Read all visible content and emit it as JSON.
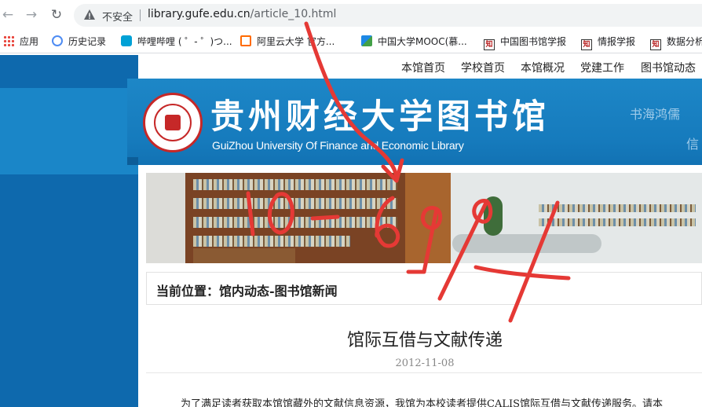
{
  "browser": {
    "not_secure": "不安全",
    "url_host": "library.gufe.edu.cn",
    "url_path": "/article_10.html",
    "bookmarks": [
      {
        "label": "应用",
        "icon": "apps-grid-icon"
      },
      {
        "label": "历史记录",
        "icon": "history-icon"
      },
      {
        "label": "哔哩哔哩 ( ゜- ゜)つ...",
        "icon": "bilibili-icon"
      },
      {
        "label": "阿里云大学 官方...",
        "icon": "aliyun-icon"
      },
      {
        "label": "中国大学MOOC(慕...",
        "icon": "mooc-icon"
      },
      {
        "label": "中国图书馆学报",
        "icon": "zhiwang-icon"
      },
      {
        "label": "情报学报",
        "icon": "zhiwang-icon"
      },
      {
        "label": "数据分析",
        "icon": "zhiwang-icon"
      }
    ]
  },
  "topnav": [
    "本馆首页",
    "学校首页",
    "本馆概况",
    "党建工作",
    "图书馆动态"
  ],
  "banner": {
    "name_cn": "贵州财经大学图书馆",
    "name_en": "GuiZhou University Of Finance and Economic Library",
    "slogan_1": "书海鸿儒",
    "slogan_2": "信"
  },
  "breadcrumb": "当前位置：馆内动态-图书馆新闻",
  "article": {
    "title": "馆际互借与文献传递",
    "date": "2012-11-08",
    "body_first_line": "为了满足读者获取本馆馆藏外的文献信息资源，我馆为本校读者提供CALIS馆际互借与文献传递服务。请本"
  },
  "handwriting": {
    "text": "10-6994",
    "color": "#e53935"
  }
}
